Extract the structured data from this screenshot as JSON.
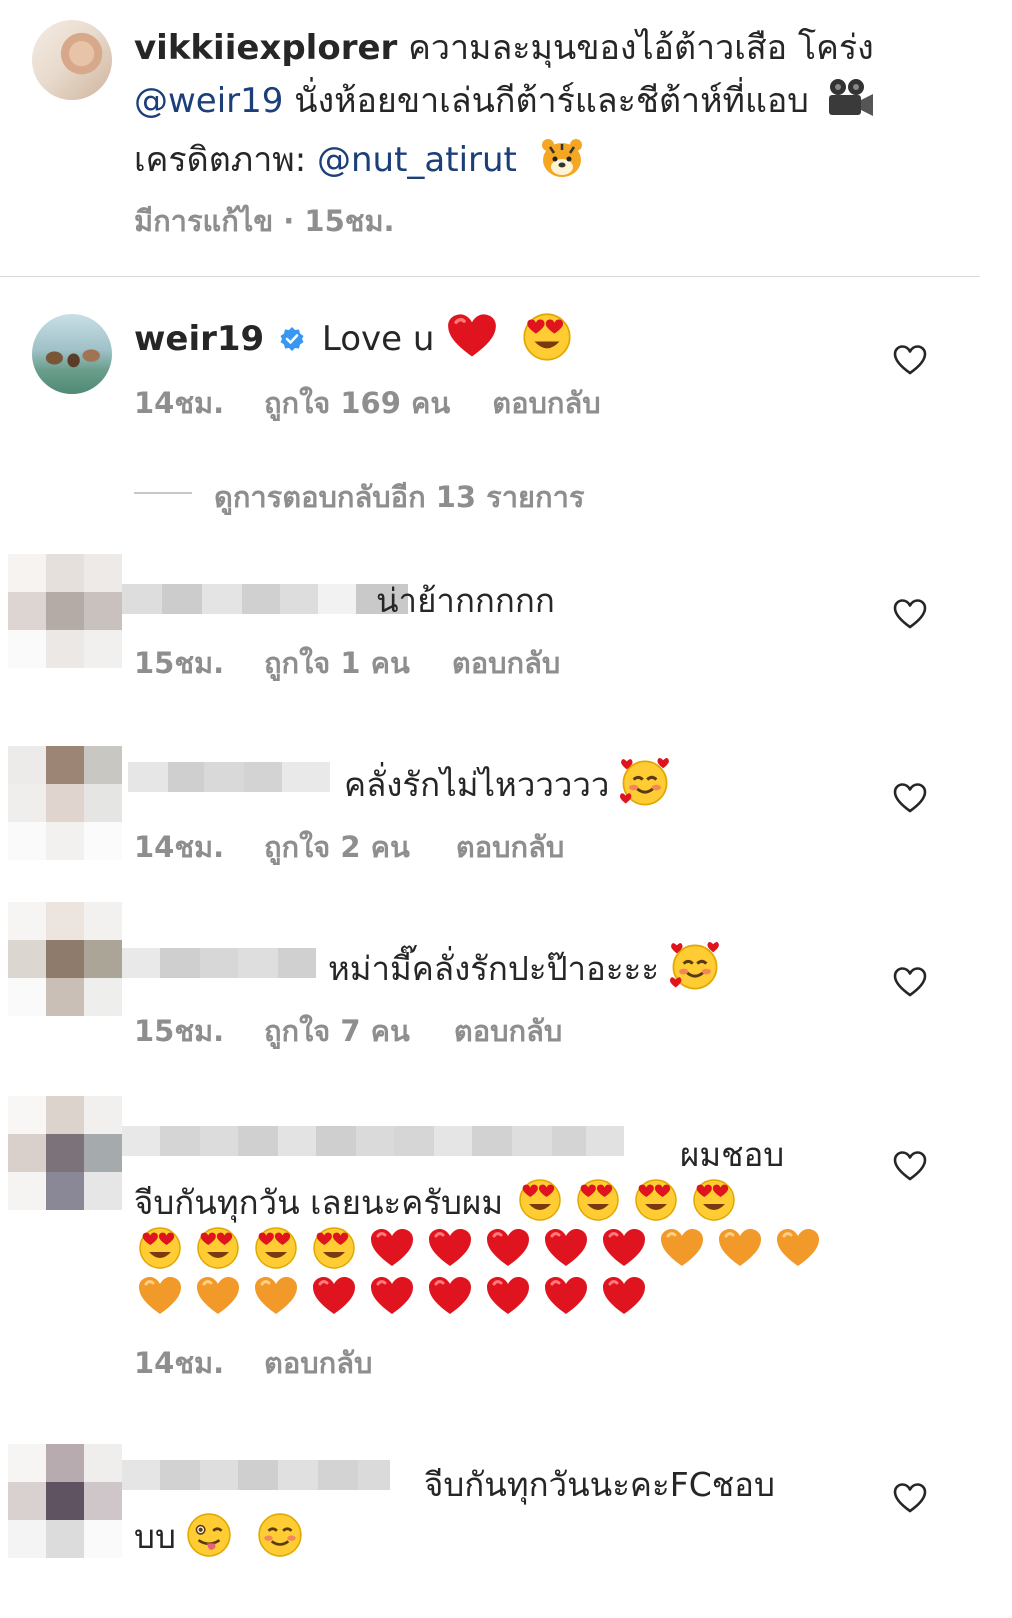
{
  "caption": {
    "username": "vikkiiexplorer",
    "line1_text": " ความละมุนของไอ้ต้าวเสือ โคร่ง",
    "mention1": "@weir19",
    "line2_text": " นั่งห้อยขาเล่นกีต้าร์และชีต้าห์ที่แอบ",
    "line3_prefix": "เครดิตภาพ: ",
    "mention2": "@nut_atirut",
    "meta": "มีการแก้ไข · 15ชม."
  },
  "comments": [
    {
      "username": "weir19",
      "text": "Love u",
      "time": "14ชม.",
      "likes": "ถูกใจ 169 คน",
      "reply": "ตอบกลับ"
    },
    {
      "text": "น่าย้ากกกกก",
      "time": "15ชม.",
      "likes": "ถูกใจ 1 คน",
      "reply": "ตอบกลับ"
    },
    {
      "text": "คลั่งรักไม่ไหววววว",
      "time": "14ชม.",
      "likes": "ถูกใจ 2 คน",
      "reply": "ตอบกลับ"
    },
    {
      "text": "หม่ามี๊คลั่งรักปะป๊าอะะะ",
      "time": "15ชม.",
      "likes": "ถูกใจ 7 คน",
      "reply": "ตอบกลับ"
    },
    {
      "text": "ผมชอบ",
      "text_line2": "จีบกันทุกวัน เลยนะครับผม",
      "time": "14ชม.",
      "reply": "ตอบกลับ"
    },
    {
      "text": "จีบกันทุกวันนะคะFCชอบ",
      "text_line2": "บบ"
    }
  ],
  "view_replies": "ดูการตอบกลับอีก 13 รายการ",
  "icons": {
    "verified": "verified-badge-icon",
    "like": "heart-outline-icon",
    "emoji": [
      "movie-camera",
      "tiger-face",
      "red-heart",
      "heart-eyes",
      "smiling-hearts",
      "orange-heart",
      "winking-tongue",
      "smiling-blush"
    ]
  },
  "colors": {
    "mention": "#1c3f79",
    "meta": "#8e8e8e",
    "verified": "#3897f0",
    "heart_red": "#e0141e",
    "heart_orange": "#f19a2a"
  }
}
